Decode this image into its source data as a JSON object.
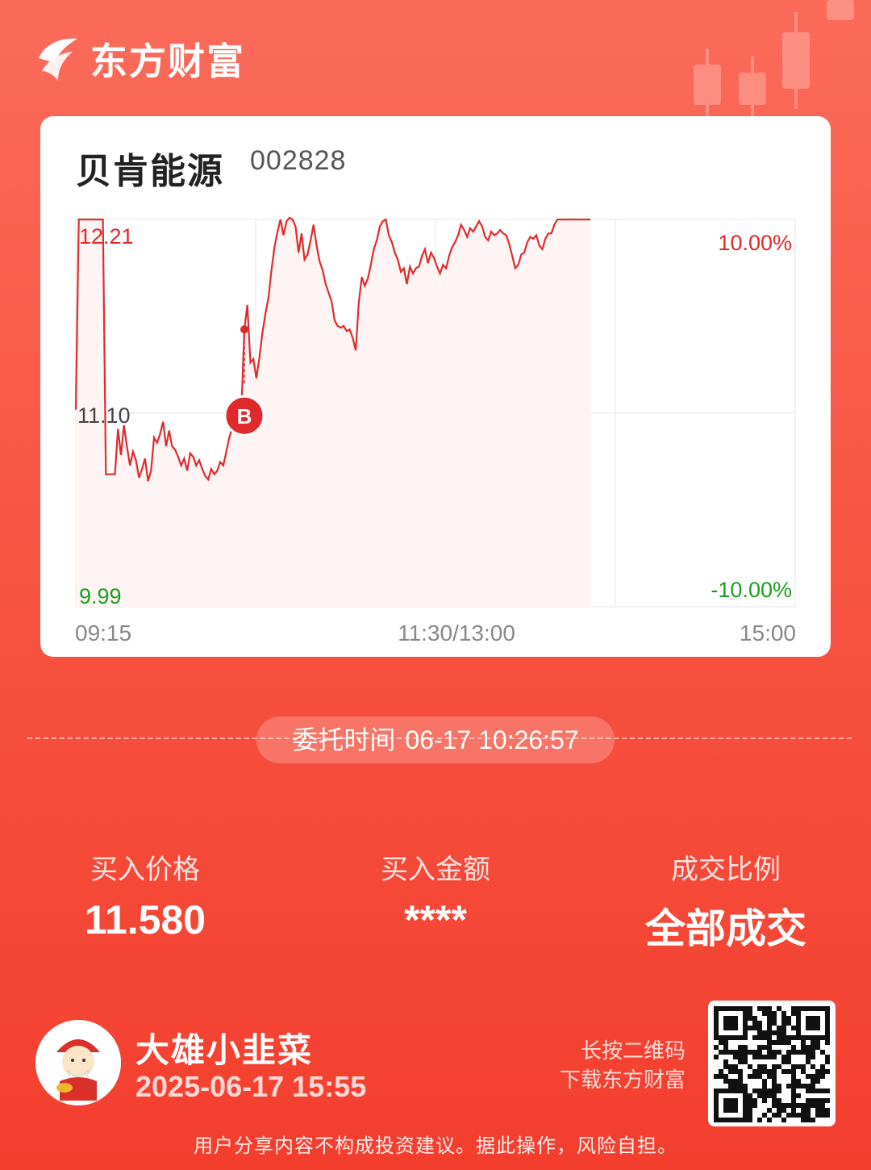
{
  "brand": {
    "name": "东方财富"
  },
  "stock": {
    "name": "贝肯能源",
    "code": "002828"
  },
  "chart_data": {
    "type": "line",
    "y_labels": {
      "top": "12.21",
      "mid": "11.10",
      "bottom": "9.99"
    },
    "pct_labels": {
      "top": "10.00%",
      "bottom": "-10.00%"
    },
    "x_labels": [
      "09:15",
      "11:30/13:00",
      "15:00"
    ],
    "ylim": [
      9.99,
      12.21
    ],
    "colors": {
      "up": "#e0292a",
      "down": "#1aa020",
      "line": "#e02b2b",
      "fill": "#fff4f4"
    },
    "buy_marker": {
      "label": "B",
      "price": 11.58,
      "index": 56
    },
    "x_total_points": 240,
    "series": [
      {
        "values": [
          11.12,
          12.21,
          12.21,
          12.21,
          12.21,
          12.21,
          12.21,
          12.21,
          12.21,
          12.21,
          10.75,
          10.75,
          10.75,
          10.75,
          11.01,
          10.86,
          11.03,
          10.91,
          10.8,
          10.88,
          10.83,
          10.73,
          10.78,
          10.84,
          10.71,
          10.77,
          10.96,
          10.93,
          10.98,
          11.05,
          10.91,
          11.0,
          10.91,
          10.89,
          10.85,
          10.8,
          10.84,
          10.77,
          10.87,
          10.85,
          10.8,
          10.83,
          10.78,
          10.74,
          10.72,
          10.78,
          10.75,
          10.77,
          10.82,
          10.8,
          10.88,
          10.96,
          11.02,
          11.01,
          11.06,
          11.12,
          11.58,
          11.72,
          11.39,
          11.41,
          11.3,
          11.42,
          11.56,
          11.67,
          11.76,
          11.92,
          12.05,
          12.14,
          12.21,
          12.12,
          12.2,
          12.22,
          12.21,
          12.17,
          12.02,
          12.13,
          11.98,
          12.01,
          12.09,
          12.18,
          12.06,
          11.97,
          11.92,
          11.84,
          11.79,
          11.74,
          11.63,
          11.6,
          11.59,
          11.6,
          11.57,
          11.58,
          11.53,
          11.46,
          11.73,
          11.88,
          11.83,
          11.87,
          11.95,
          12.04,
          12.09,
          12.17,
          12.2,
          12.21,
          12.12,
          12.08,
          12.02,
          11.98,
          11.91,
          11.93,
          11.84,
          11.94,
          11.9,
          11.93,
          11.94,
          12.0,
          12.04,
          11.96,
          12.02,
          11.99,
          11.94,
          11.9,
          11.95,
          11.93,
          12.0,
          12.05,
          12.08,
          12.12,
          12.18,
          12.15,
          12.11,
          12.16,
          12.14,
          12.17,
          12.2,
          12.17,
          12.11,
          12.09,
          12.14,
          12.12,
          12.13,
          12.15,
          12.13,
          12.12,
          12.07,
          12.0,
          11.93,
          11.95,
          12.01,
          12.02,
          12.08,
          12.11,
          12.1,
          12.12,
          12.06,
          12.04,
          12.1,
          12.13,
          12.13,
          12.18,
          12.21,
          12.21,
          12.21,
          12.21,
          12.21,
          12.21,
          12.21,
          12.21,
          12.21,
          12.21,
          12.21,
          12.21
        ],
        "name": ""
      }
    ]
  },
  "order": {
    "label": "委托时间",
    "time": "06-17 10:26:57"
  },
  "metrics": [
    {
      "label": "买入价格",
      "value": "11.580"
    },
    {
      "label": "买入金额",
      "value": "****"
    },
    {
      "label": "成交比例",
      "value": "全部成交"
    }
  ],
  "user": {
    "name": "大雄小韭菜",
    "time": "2025-06-17 15:55"
  },
  "qr": {
    "hint_line1": "长按二维码",
    "hint_line2": "下载东方财富"
  },
  "disclaimer": "用户分享内容不构成投资建议。据此操作，风险自担。"
}
